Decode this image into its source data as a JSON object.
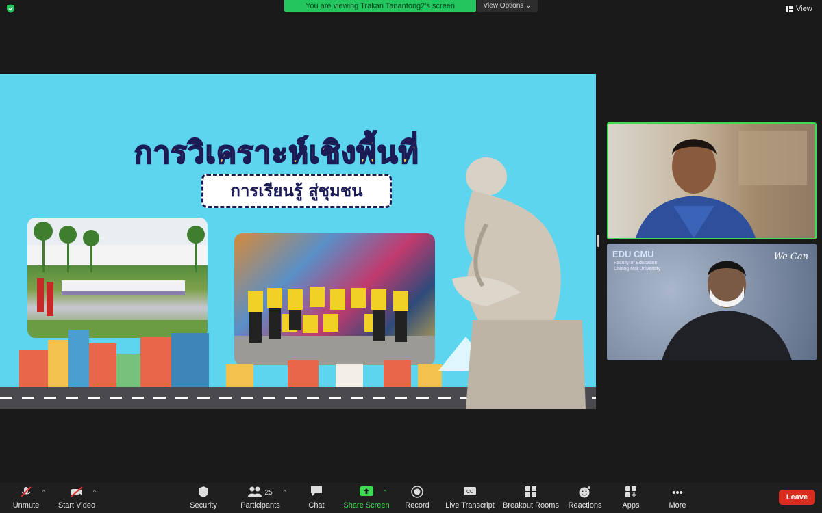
{
  "top": {
    "banner_text": "You are viewing Trakan Tanantong2's screen",
    "view_options_label": "View Options",
    "view_label": "View"
  },
  "slide": {
    "title": "การวิเคราะห์เชิงพื้นที่",
    "subtitle": "การเรียนรู้ สู่ชุมชน"
  },
  "participants_panel": {
    "tile2_logo": "EDU CMU",
    "tile2_logo_sub1": "Faculty of Education",
    "tile2_logo_sub2": "Chiang Mai University",
    "tile2_logo_right": "We Can"
  },
  "toolbar": {
    "unmute": "Unmute",
    "start_video": "Start Video",
    "security": "Security",
    "participants": "Participants",
    "participants_count": "25",
    "chat": "Chat",
    "share_screen": "Share Screen",
    "record": "Record",
    "live_transcript": "Live Transcript",
    "breakout_rooms": "Breakout Rooms",
    "reactions": "Reactions",
    "apps": "Apps",
    "more": "More",
    "leave": "Leave"
  },
  "colors": {
    "accent_green": "#22c55e",
    "leave_red": "#d92d20",
    "slide_bg": "#5dd5ef",
    "title_yellow": "#ffd83a"
  },
  "icons": [
    "shield-check-icon",
    "mic-muted-icon",
    "video-off-icon",
    "security-icon",
    "participants-icon",
    "chat-icon",
    "share-screen-icon",
    "record-icon",
    "cc-icon",
    "breakout-icon",
    "reactions-icon",
    "apps-icon",
    "more-icon",
    "view-grid-icon"
  ]
}
